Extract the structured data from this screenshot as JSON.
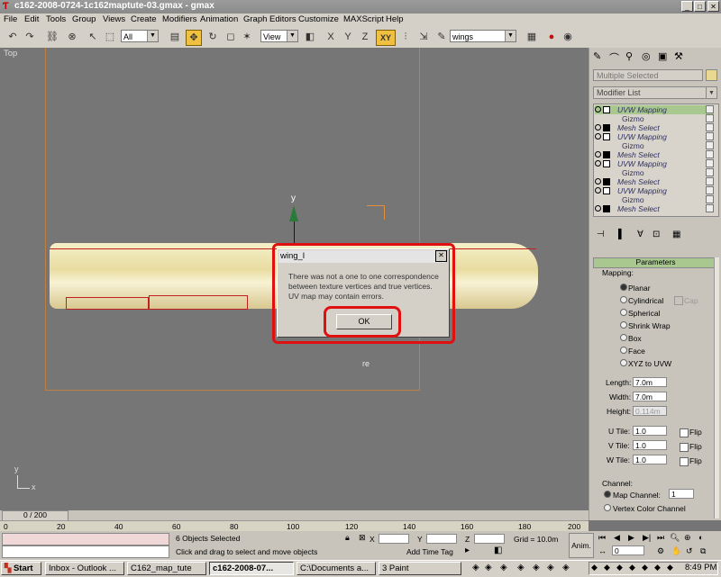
{
  "window": {
    "title": "c162-2008-0724-1c162maptute-03.gmax - gmax",
    "min": "_",
    "max": "□",
    "close": "✕"
  },
  "menu": [
    "File",
    "Edit",
    "Tools",
    "Group",
    "Views",
    "Create",
    "Modifiers",
    "Animation",
    "Graph Editors",
    "Customize",
    "MAXScript",
    "Help"
  ],
  "toolbar": {
    "selection_filter": "All",
    "ref_coord": "View",
    "named_selection": "wings",
    "axis_constraint": "XY"
  },
  "viewport": {
    "label": "Top",
    "axis_y": "y",
    "axis_x": "x",
    "corner_y": "y",
    "corner_x": "x",
    "wing_label": "re"
  },
  "dialog": {
    "title": "wing_l",
    "message": "There was not a one to one correspondence between texture vertices and true vertices. UV map may contain errors.",
    "ok": "OK"
  },
  "panel": {
    "name_field": "Multiple Selected",
    "modifier_list": "Modifier List",
    "stack": [
      "UVW Mapping",
      "Gizmo",
      "Mesh Select",
      "UVW Mapping",
      "Gizmo",
      "Mesh Select",
      "UVW Mapping",
      "Gizmo",
      "Mesh Select",
      "UVW Mapping",
      "Gizmo",
      "Mesh Select"
    ],
    "rollout": "Parameters",
    "mapping_label": "Mapping:",
    "mapping_options": [
      "Planar",
      "Cylindrical",
      "Spherical",
      "Shrink Wrap",
      "Box",
      "Face",
      "XYZ to UVW"
    ],
    "cap": "Cap",
    "length_label": "Length:",
    "length": "7.0m",
    "width_label": "Width:",
    "width": "7.0m",
    "height_label": "Height:",
    "height": "0.114m",
    "utile_label": "U Tile:",
    "utile": "1.0",
    "vtile_label": "V Tile:",
    "vtile": "1.0",
    "wtile_label": "W Tile:",
    "wtile": "1.0",
    "flip": "Flip",
    "channel_label": "Channel:",
    "map_channel": "Map Channel:",
    "map_channel_value": "1",
    "vertex_color_channel": "Vertex Color Channel"
  },
  "timeline": {
    "counter": "0 / 200",
    "ticks": [
      "0",
      "20",
      "40",
      "60",
      "80",
      "100",
      "120",
      "140",
      "160",
      "180",
      "200"
    ]
  },
  "status": {
    "selected": "6 Objects Selected",
    "prompt": "Click and drag to select and move objects",
    "x_label": "X",
    "y_label": "Y",
    "z_label": "Z",
    "grid": "Grid = 10.0m",
    "add_time_tag": "Add Time Tag",
    "anim": "Anim.",
    "frame": "0"
  },
  "taskbar": {
    "start": "Start",
    "tasks": [
      "Inbox - Outlook ...",
      "C162_map_tute",
      "c162-2008-07...",
      "C:\\Documents a...",
      "3 Paint"
    ],
    "clock": "8:49 PM"
  },
  "colors": {
    "red_highlight": "#e01010",
    "frame_orange": "#c08040",
    "gizmo_green": "#2a7a3a"
  }
}
